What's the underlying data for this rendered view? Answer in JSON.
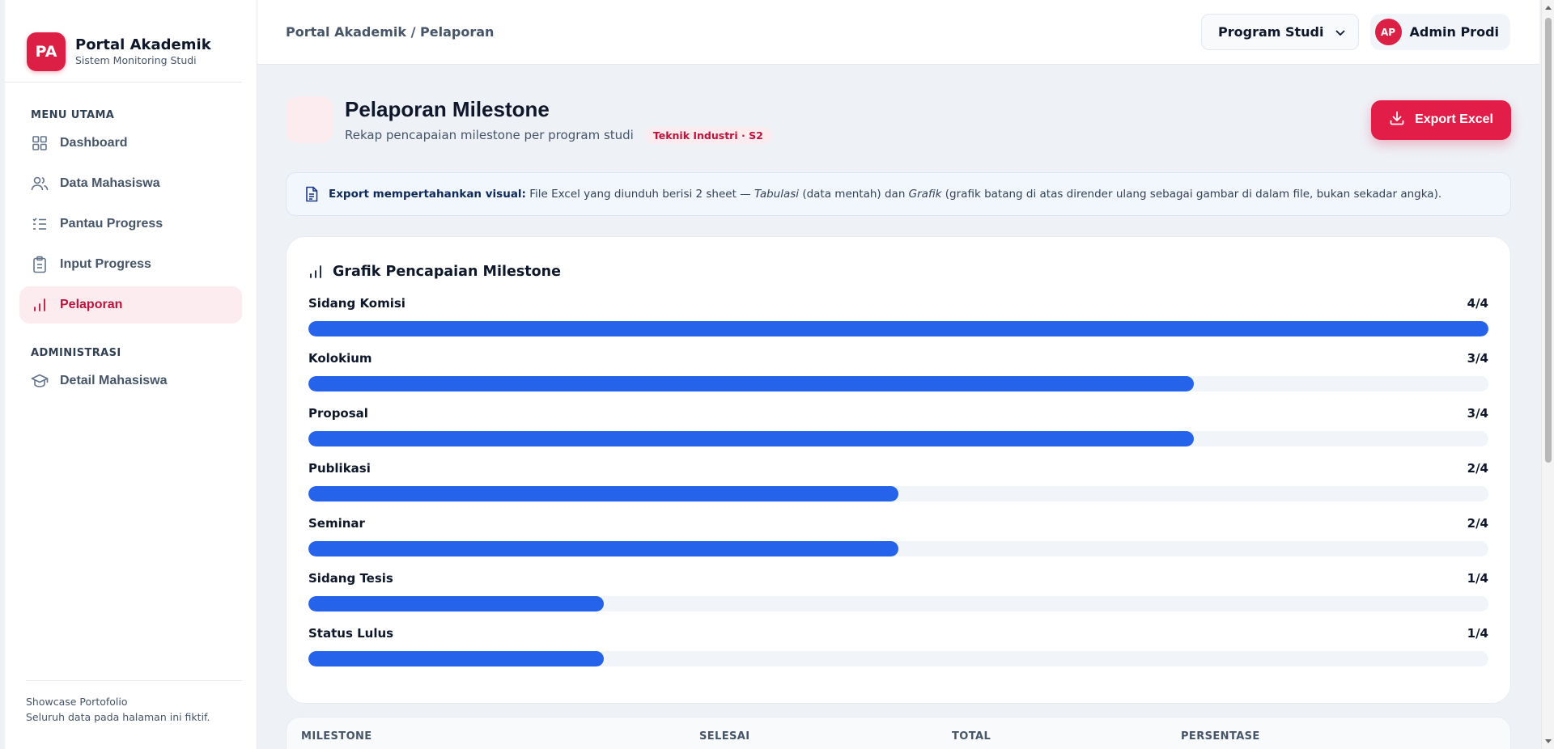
{
  "brand": {
    "logo": "PA",
    "title": "Portal Akademik",
    "subtitle": "Sistem Monitoring Studi"
  },
  "sidebar": {
    "main_heading": "MENU UTAMA",
    "items": [
      {
        "label": "Dashboard",
        "icon": "grid-icon",
        "active": false
      },
      {
        "label": "Data Mahasiswa",
        "icon": "users-icon",
        "active": false
      },
      {
        "label": "Pantau Progress",
        "icon": "list-check-icon",
        "active": false
      },
      {
        "label": "Input Progress",
        "icon": "clipboard-icon",
        "active": false
      },
      {
        "label": "Pelaporan",
        "icon": "bar-chart-icon",
        "active": true
      }
    ],
    "admin_heading": "ADMINISTRASI",
    "admin_items": [
      {
        "label": "Detail Mahasiswa",
        "icon": "graduation-cap-icon"
      }
    ],
    "footer": {
      "line1": "Showcase Portofolio",
      "line2": "Seluruh data pada halaman ini fiktif."
    }
  },
  "topbar": {
    "breadcrumb": "Portal Akademik / Pelaporan",
    "program_select": "Program Studi",
    "user": {
      "initials": "AP",
      "name": "Admin Prodi"
    }
  },
  "page": {
    "title": "Pelaporan Milestone",
    "subtitle": "Rekap pencapaian milestone per program studi",
    "badge": "Teknik Industri · S2",
    "export_label": "Export Excel"
  },
  "info": {
    "bold": "Export mempertahankan visual:",
    "text1": " File Excel yang diunduh berisi 2 sheet — ",
    "italic1": "Tabulasi",
    "text2": " (data mentah) dan ",
    "italic2": "Grafik",
    "text3": " (grafik batang di atas dirender ulang sebagai gambar di dalam file, bukan sekadar angka)."
  },
  "chart_data": {
    "type": "bar",
    "title": "Grafik Pencapaian Milestone",
    "categories": [
      "Sidang Komisi",
      "Kolokium",
      "Proposal",
      "Publikasi",
      "Seminar",
      "Sidang Tesis",
      "Status Lulus"
    ],
    "values": [
      4,
      3,
      3,
      2,
      2,
      1,
      1
    ],
    "totals": [
      4,
      4,
      4,
      4,
      4,
      4,
      4
    ],
    "value_labels": [
      "4/4",
      "3/4",
      "3/4",
      "2/4",
      "2/4",
      "1/4",
      "1/4"
    ],
    "xlim": [
      0,
      4
    ],
    "bar_color": "#2563eb"
  },
  "table": {
    "headers": [
      "MILESTONE",
      "SELESAI",
      "TOTAL",
      "PERSENTASE"
    ]
  },
  "colors": {
    "accent": "#e11d48",
    "bar": "#2563eb"
  }
}
